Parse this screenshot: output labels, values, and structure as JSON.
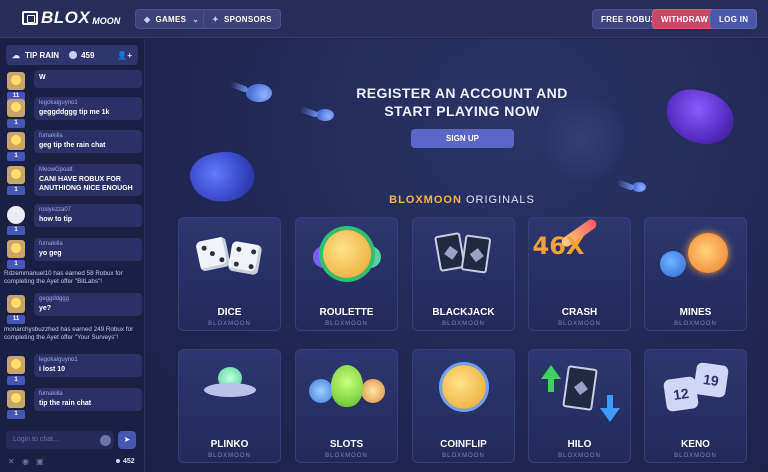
{
  "topbar": {
    "logo_main": "BLOX",
    "logo_sub": "MOON",
    "games_label": "GAMES",
    "sponsors_label": "SPONSORS",
    "free_robux_label": "FREE ROBUX",
    "withdraw_label": "WITHDRAW",
    "login_label": "LOG IN",
    "colors": {
      "withdraw": "#c64a64",
      "login": "#4a56a8"
    }
  },
  "sidebar": {
    "tip_rain_label": "TIP RAIN",
    "rain_amount": "459",
    "chat": [
      {
        "type": "user",
        "username": "",
        "text": "W",
        "level": "11"
      },
      {
        "type": "user",
        "username": "legokalguyno1",
        "text": "geggddggg tip me 1k",
        "level": "1"
      },
      {
        "type": "user",
        "username": "fumakiila",
        "text": "geg tip the rain chat",
        "level": "1"
      },
      {
        "type": "user",
        "username": "MeowGpoalt",
        "text": "CANI HAVE ROBUX FOR ANUTHIONG NICE ENOUGH",
        "level": "1"
      },
      {
        "type": "user",
        "username": "rosiyezza07",
        "text": "how to tip",
        "level": "1"
      },
      {
        "type": "user",
        "username": "fumakiila",
        "text": "yo geg",
        "level": "1"
      },
      {
        "type": "system",
        "text": "Rdzemmanuel10 has earned 58 Robux for completing the Ayet offer \"BitLabs\"!"
      },
      {
        "type": "user",
        "username": "geggddggg",
        "text": "ye?",
        "level": "11"
      },
      {
        "type": "system",
        "text": "monarchysbuzzhed has earned 249 Robux for completing the Ayet offer \"Your Surveys\"!"
      },
      {
        "type": "user",
        "username": "legokalguyno1",
        "text": "i lost 10",
        "level": "1"
      },
      {
        "type": "user",
        "username": "fumakiila",
        "text": "tip the rain chat",
        "level": "1"
      }
    ],
    "input_placeholder": "Login to chat...",
    "online_count": "452"
  },
  "main": {
    "hero_title_line1": "REGISTER AN ACCOUNT AND",
    "hero_title_line2": "START PLAYING NOW",
    "signup_label": "SIGN UP",
    "originals_accent": "BLOXMOON",
    "originals_rest": "ORIGINALS",
    "games": [
      {
        "name": "DICE",
        "sub": "BLOXMOON"
      },
      {
        "name": "ROULETTE",
        "sub": "BLOXMOON"
      },
      {
        "name": "BLACKJACK",
        "sub": "BLOXMOON"
      },
      {
        "name": "CRASH",
        "sub": "BLOXMOON"
      },
      {
        "name": "MINES",
        "sub": "BLOXMOON"
      },
      {
        "name": "PLINKO",
        "sub": "BLOXMOON"
      },
      {
        "name": "SLOTS",
        "sub": "BLOXMOON"
      },
      {
        "name": "COINFLIP",
        "sub": "BLOXMOON"
      },
      {
        "name": "HILO",
        "sub": "BLOXMOON"
      },
      {
        "name": "KENO",
        "sub": "BLOXMOON"
      }
    ],
    "crash_multiplier": "46X",
    "keno_numbers": [
      "12",
      "19"
    ],
    "accent_color": "#f5b445"
  }
}
